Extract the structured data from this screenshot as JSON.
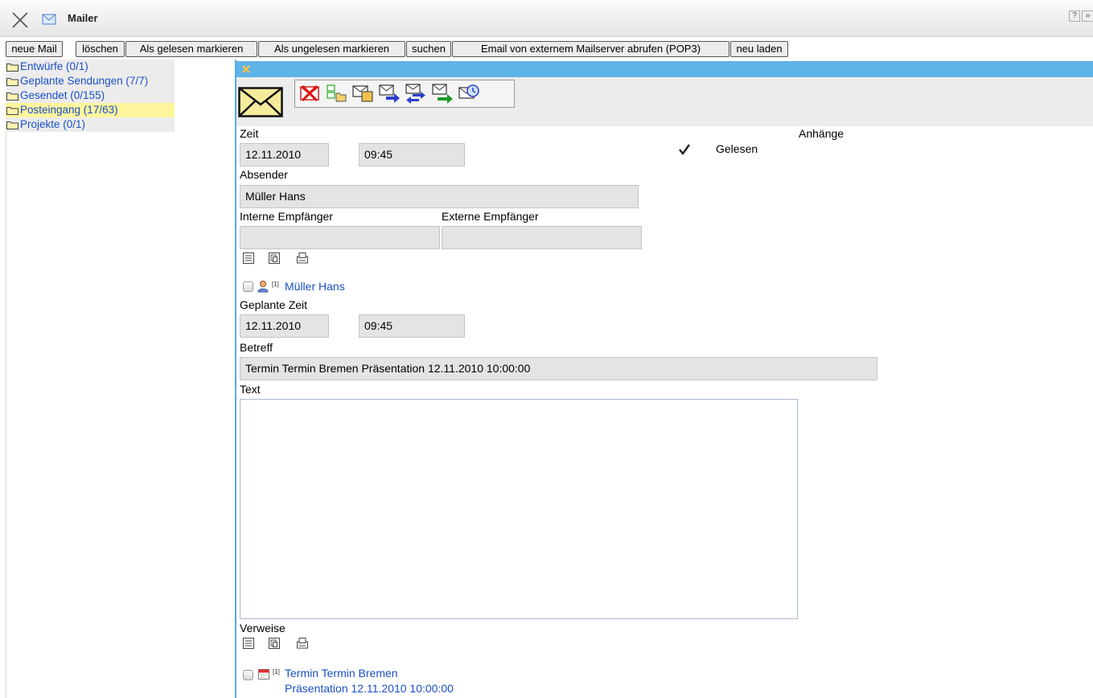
{
  "window": {
    "title": "Mailer",
    "help_label": "?",
    "more_label": "»"
  },
  "toolbar": {
    "buttons": [
      "neue Mail",
      "löschen",
      "Als gelesen markieren",
      "Als ungelesen markieren",
      "suchen",
      "Email von externem Mailserver abrufen (POP3)",
      "neu laden"
    ]
  },
  "folders": [
    {
      "label": "Entwürfe (0/1)",
      "selected": false
    },
    {
      "label": "Geplante Sendungen (7/7)",
      "selected": false
    },
    {
      "label": "Gesendet (0/155)",
      "selected": false
    },
    {
      "label": "Posteingang (17/63)",
      "selected": true
    },
    {
      "label": "Projekte (0/1)",
      "selected": false
    }
  ],
  "mail": {
    "zeit_label": "Zeit",
    "date": "12.11.2010",
    "time": "09:45",
    "anhaenge_label": "Anhänge",
    "gelesen_label": "Gelesen",
    "gelesen_checked": true,
    "absender_label": "Absender",
    "absender": "Müller Hans",
    "interne_label": "Interne Empfänger",
    "interne": "",
    "externe_label": "Externe Empfänger",
    "externe": "",
    "recipient_sup": "[1]",
    "recipient_link": "Müller Hans",
    "geplante_label": "Geplante Zeit",
    "geplante_date": "12.11.2010",
    "geplante_time": "09:45",
    "betreff_label": "Betreff",
    "betreff": "Termin Termin Bremen  Präsentation 12.11.2010 10:00:00",
    "text_label": "Text",
    "text": "",
    "verweise_label": "Verweise",
    "ref_sup": "[1]",
    "ref_line1": "Termin Termin Bremen",
    "ref_line2": "Präsentation 12.11.2010 10:00:00"
  },
  "colors": {
    "accent_blue": "#5eb3e8",
    "link_blue": "#1a4fc8",
    "selected_folder": "#fff59d"
  }
}
